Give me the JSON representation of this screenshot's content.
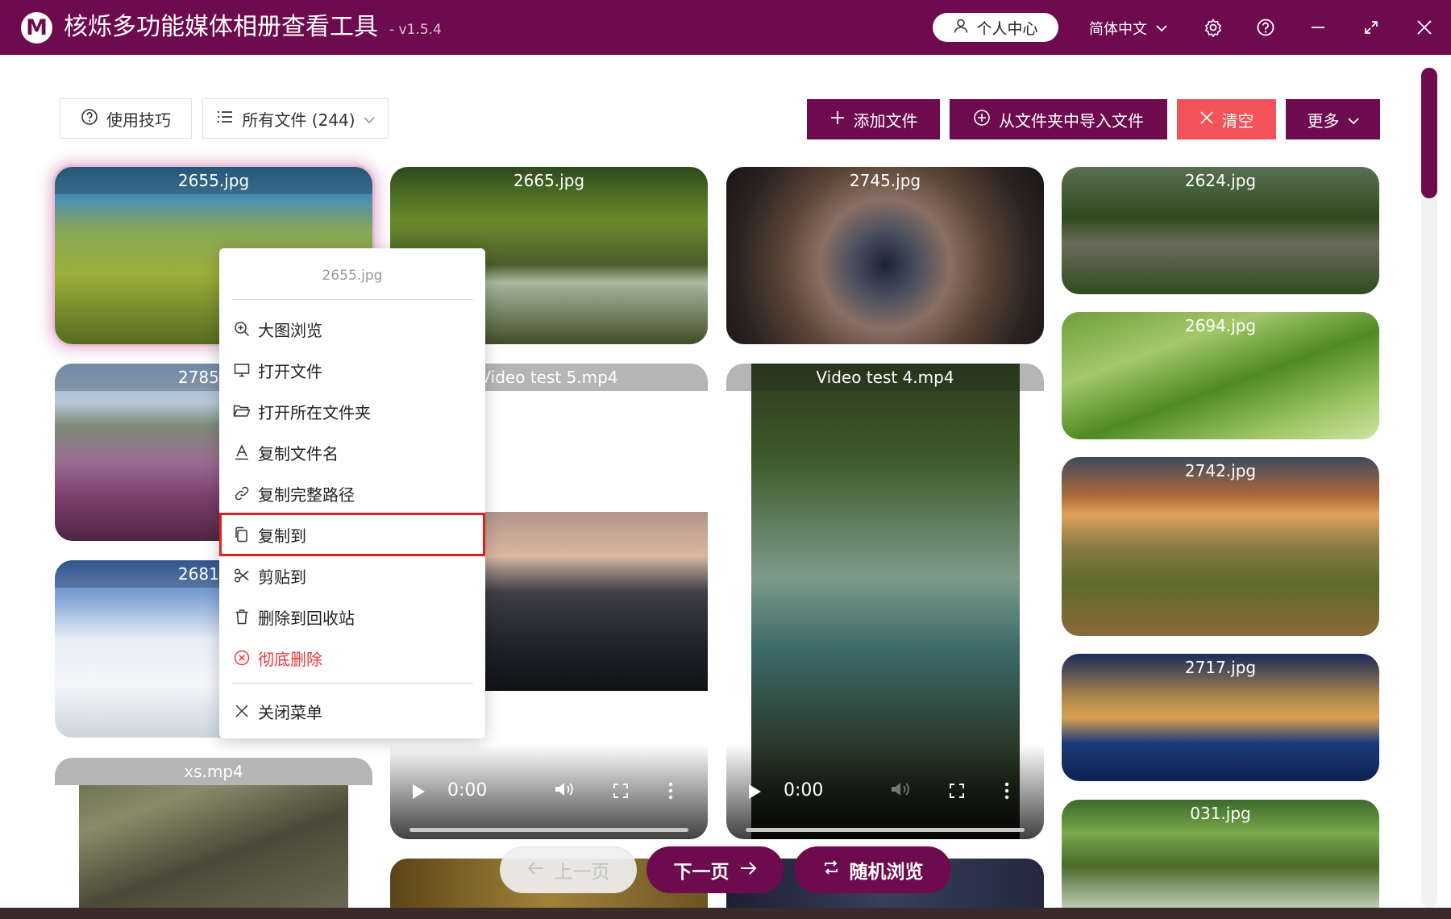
{
  "app": {
    "logo_letter": "M",
    "title": "核烁多功能媒体相册查看工具",
    "version": "- v1.5.4",
    "user_center": "个人中心",
    "language": "简体中文",
    "accent_color": "#6e0a4e"
  },
  "toolbar": {
    "tips": "使用技巧",
    "filter": "所有文件 (244)",
    "add_files": "添加文件",
    "import_folder": "从文件夹中导入文件",
    "clear": "清空",
    "more": "更多"
  },
  "cards": {
    "c1": {
      "name": "2655.jpg"
    },
    "c2": {
      "name": "2785.jpg"
    },
    "c3": {
      "name": "2681.jpg"
    },
    "c4": {
      "name": "xs.mp4"
    },
    "c5": {
      "name": "2665.jpg"
    },
    "c6": {
      "name": "Video test 5.mp4",
      "time": "0:00"
    },
    "c7": {
      "name": "2745.jpg"
    },
    "c8": {
      "name": "Video test 4.mp4",
      "time": "0:00"
    },
    "c9": {
      "name": "2624.jpg"
    },
    "c10": {
      "name": "2694.jpg"
    },
    "c11": {
      "name": "2742.jpg"
    },
    "c12": {
      "name": "2717.jpg"
    },
    "c13": {
      "name": "031.jpg"
    }
  },
  "context_menu": {
    "title": "2655.jpg",
    "items": [
      {
        "label": "大图浏览",
        "icon": "zoom-in-icon"
      },
      {
        "label": "打开文件",
        "icon": "monitor-icon"
      },
      {
        "label": "打开所在文件夹",
        "icon": "folder-open-icon"
      },
      {
        "label": "复制文件名",
        "icon": "text-icon"
      },
      {
        "label": "复制完整路径",
        "icon": "link-icon"
      },
      {
        "label": "复制到",
        "icon": "copy-icon",
        "highlighted": true
      },
      {
        "label": "剪贴到",
        "icon": "scissors-icon"
      },
      {
        "label": "删除到回收站",
        "icon": "trash-icon"
      },
      {
        "label": "彻底删除",
        "icon": "delete-circle-icon",
        "danger": true
      },
      {
        "label": "关闭菜单",
        "icon": "close-icon"
      }
    ]
  },
  "pager": {
    "prev": "上一页",
    "next": "下一页",
    "random": "随机浏览"
  }
}
